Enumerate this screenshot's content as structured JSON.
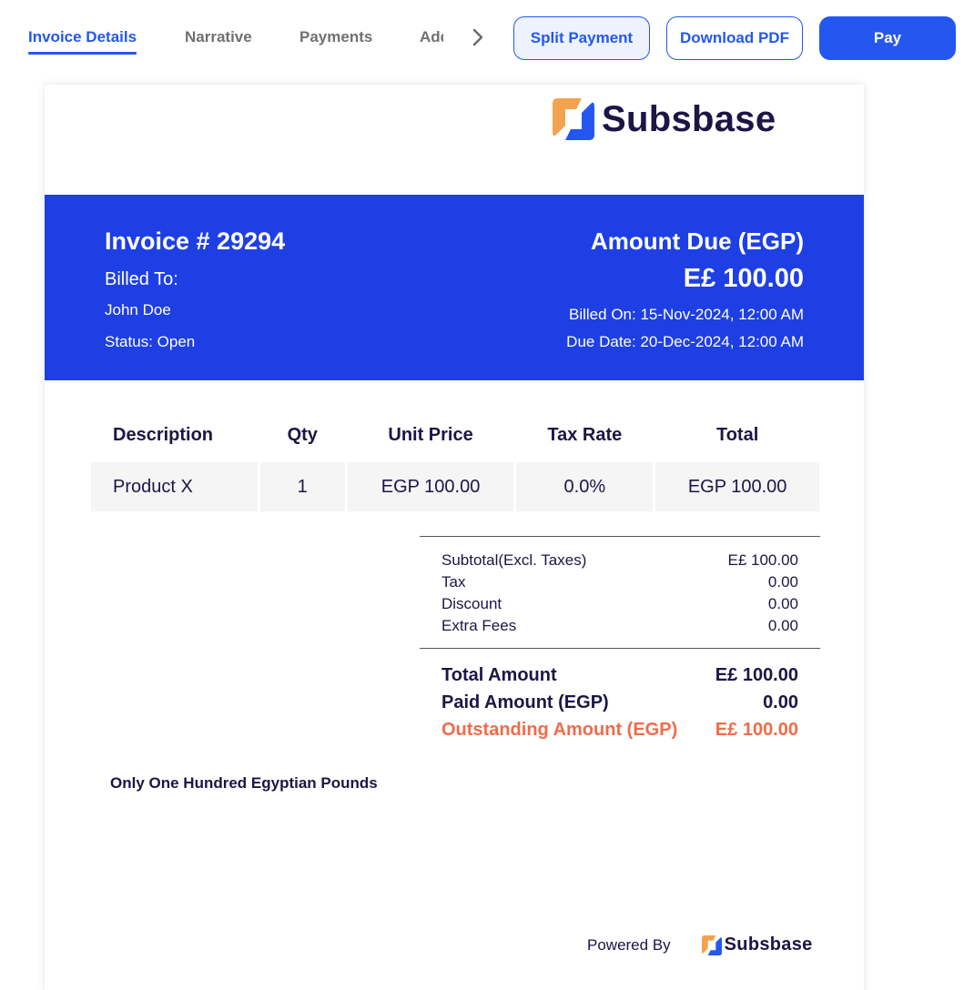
{
  "tabs": [
    {
      "label": "Invoice Details",
      "active": true
    },
    {
      "label": "Narrative",
      "active": false
    },
    {
      "label": "Payments",
      "active": false
    },
    {
      "label": "Additional",
      "active": false
    }
  ],
  "tabs_scroll_icon": "chevron-right-icon",
  "actions": {
    "split_payment": "Split Payment",
    "download_pdf": "Download PDF",
    "pay": "Pay"
  },
  "brand": {
    "name": "Subsbase",
    "logo_icon": "subsbase-logo-icon",
    "colors": {
      "primary": "#1e3fe4",
      "accent": "#2457f0",
      "logo_orange": "#f2a34f",
      "outstanding": "#ef6c4a",
      "text_dark": "#1b1646"
    }
  },
  "invoice": {
    "number_label": "Invoice # 29294",
    "billed_to_label": "Billed To:",
    "customer_name": "John Doe",
    "status": "Status: Open",
    "amount_due_label": "Amount Due (EGP)",
    "amount_due": "E£ 100.00",
    "billed_on": "Billed On: 15-Nov-2024, 12:00 AM",
    "due_date": "Due Date: 20-Dec-2024, 12:00 AM"
  },
  "items": {
    "headers": [
      "Description",
      "Qty",
      "Unit Price",
      "Tax Rate",
      "Total"
    ],
    "rows": [
      [
        "Product X",
        "1",
        "EGP 100.00",
        "0.0%",
        "EGP 100.00"
      ]
    ]
  },
  "summary": {
    "lines": [
      {
        "label": "Subtotal(Excl. Taxes)",
        "value": "E£ 100.00"
      },
      {
        "label": "Tax",
        "value": "0.00"
      },
      {
        "label": "Discount",
        "value": "0.00"
      },
      {
        "label": "Extra Fees",
        "value": "0.00"
      }
    ],
    "totals": [
      {
        "label": "Total Amount",
        "value": "E£ 100.00"
      },
      {
        "label": "Paid Amount (EGP)",
        "value": "0.00"
      },
      {
        "label": "Outstanding Amount (EGP)",
        "value": "E£ 100.00"
      }
    ]
  },
  "amount_in_words": "Only One Hundred Egyptian Pounds",
  "footer": {
    "powered_by": "Powered By",
    "brand": "Subsbase"
  }
}
